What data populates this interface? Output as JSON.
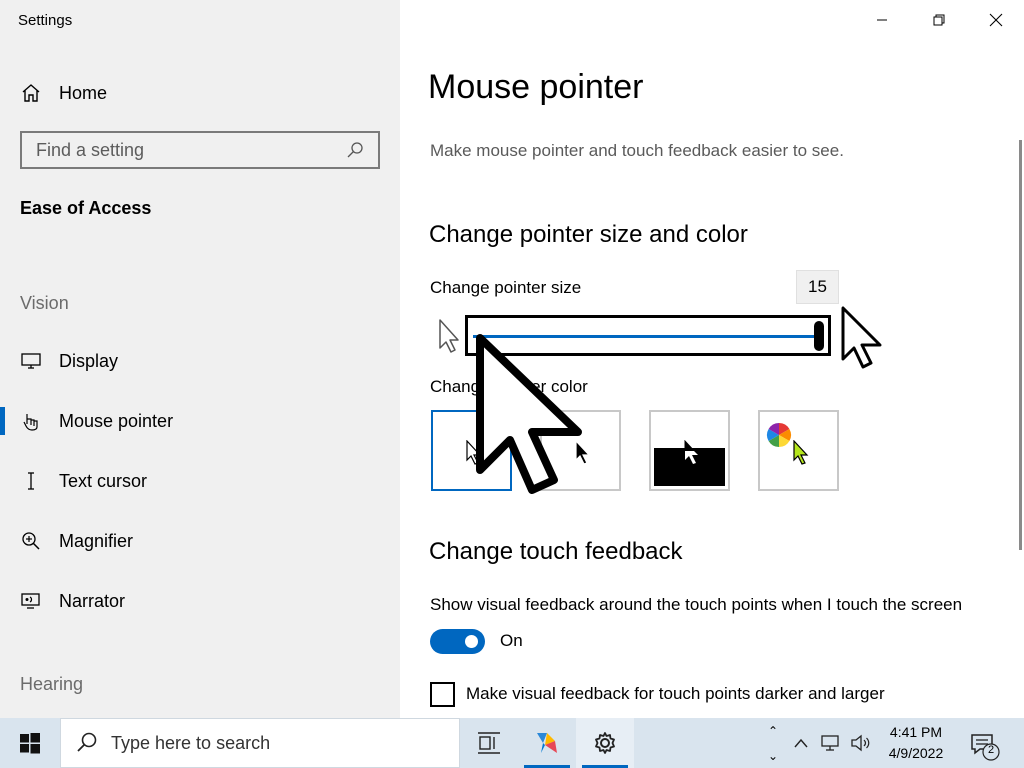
{
  "window": {
    "title": "Settings",
    "controls": {
      "minimize": "minimize",
      "maximize": "restore",
      "close": "close"
    }
  },
  "sidebar": {
    "home_label": "Home",
    "search_placeholder": "Find a setting",
    "current_section": "Ease of Access",
    "group_vision": "Vision",
    "items": [
      {
        "label": "Display",
        "icon": "display-icon"
      },
      {
        "label": "Mouse pointer",
        "icon": "mouse-pointer-icon",
        "selected": true
      },
      {
        "label": "Text cursor",
        "icon": "text-cursor-icon"
      },
      {
        "label": "Magnifier",
        "icon": "magnifier-icon"
      },
      {
        "label": "Narrator",
        "icon": "narrator-icon"
      }
    ],
    "group_hearing": "Hearing"
  },
  "main": {
    "title": "Mouse pointer",
    "description": "Make mouse pointer and touch feedback easier to see.",
    "section_size_color": "Change pointer size and color",
    "pointer_size_label": "Change pointer size",
    "pointer_size_value": "15",
    "pointer_size_slider_fraction": 1.0,
    "pointer_color_label": "Change pointer color",
    "pointer_color_options": [
      {
        "name": "white",
        "selected": true
      },
      {
        "name": "black",
        "selected": false
      },
      {
        "name": "inverted",
        "selected": false
      },
      {
        "name": "custom",
        "selected": false
      }
    ],
    "section_touch": "Change touch feedback",
    "touch_feedback_label": "Show visual feedback around the touch points when I touch the screen",
    "touch_toggle_state": "On",
    "touch_darker_label": "Make visual feedback for touch points darker and larger",
    "touch_darker_checked": false
  },
  "taskbar": {
    "search_placeholder": "Type here to search",
    "clock_time": "4:41 PM",
    "clock_date": "4/9/2022",
    "notification_count": "2"
  },
  "colors": {
    "accent": "#0067c0",
    "sidebar_bg": "#f0f0f0",
    "taskbar_bg": "#d9e4ee"
  }
}
